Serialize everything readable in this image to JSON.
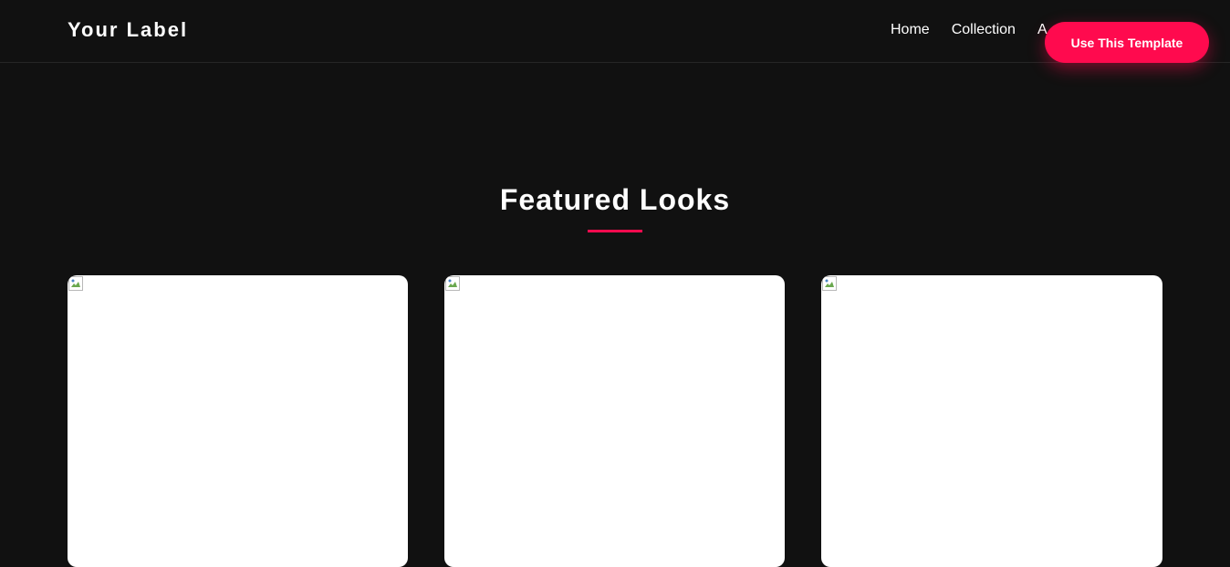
{
  "brand": {
    "logo_text": "Your Label",
    "accent_color": "#ff0a4e",
    "background_color": "#111111"
  },
  "nav": {
    "links": [
      {
        "label": "Home"
      },
      {
        "label": "Collection"
      },
      {
        "label": "A"
      }
    ],
    "cta_label": "Use This Template"
  },
  "featured": {
    "title": "Featured Looks",
    "cards": [
      {
        "image": "broken-image-icon"
      },
      {
        "image": "broken-image-icon"
      },
      {
        "image": "broken-image-icon"
      }
    ]
  }
}
